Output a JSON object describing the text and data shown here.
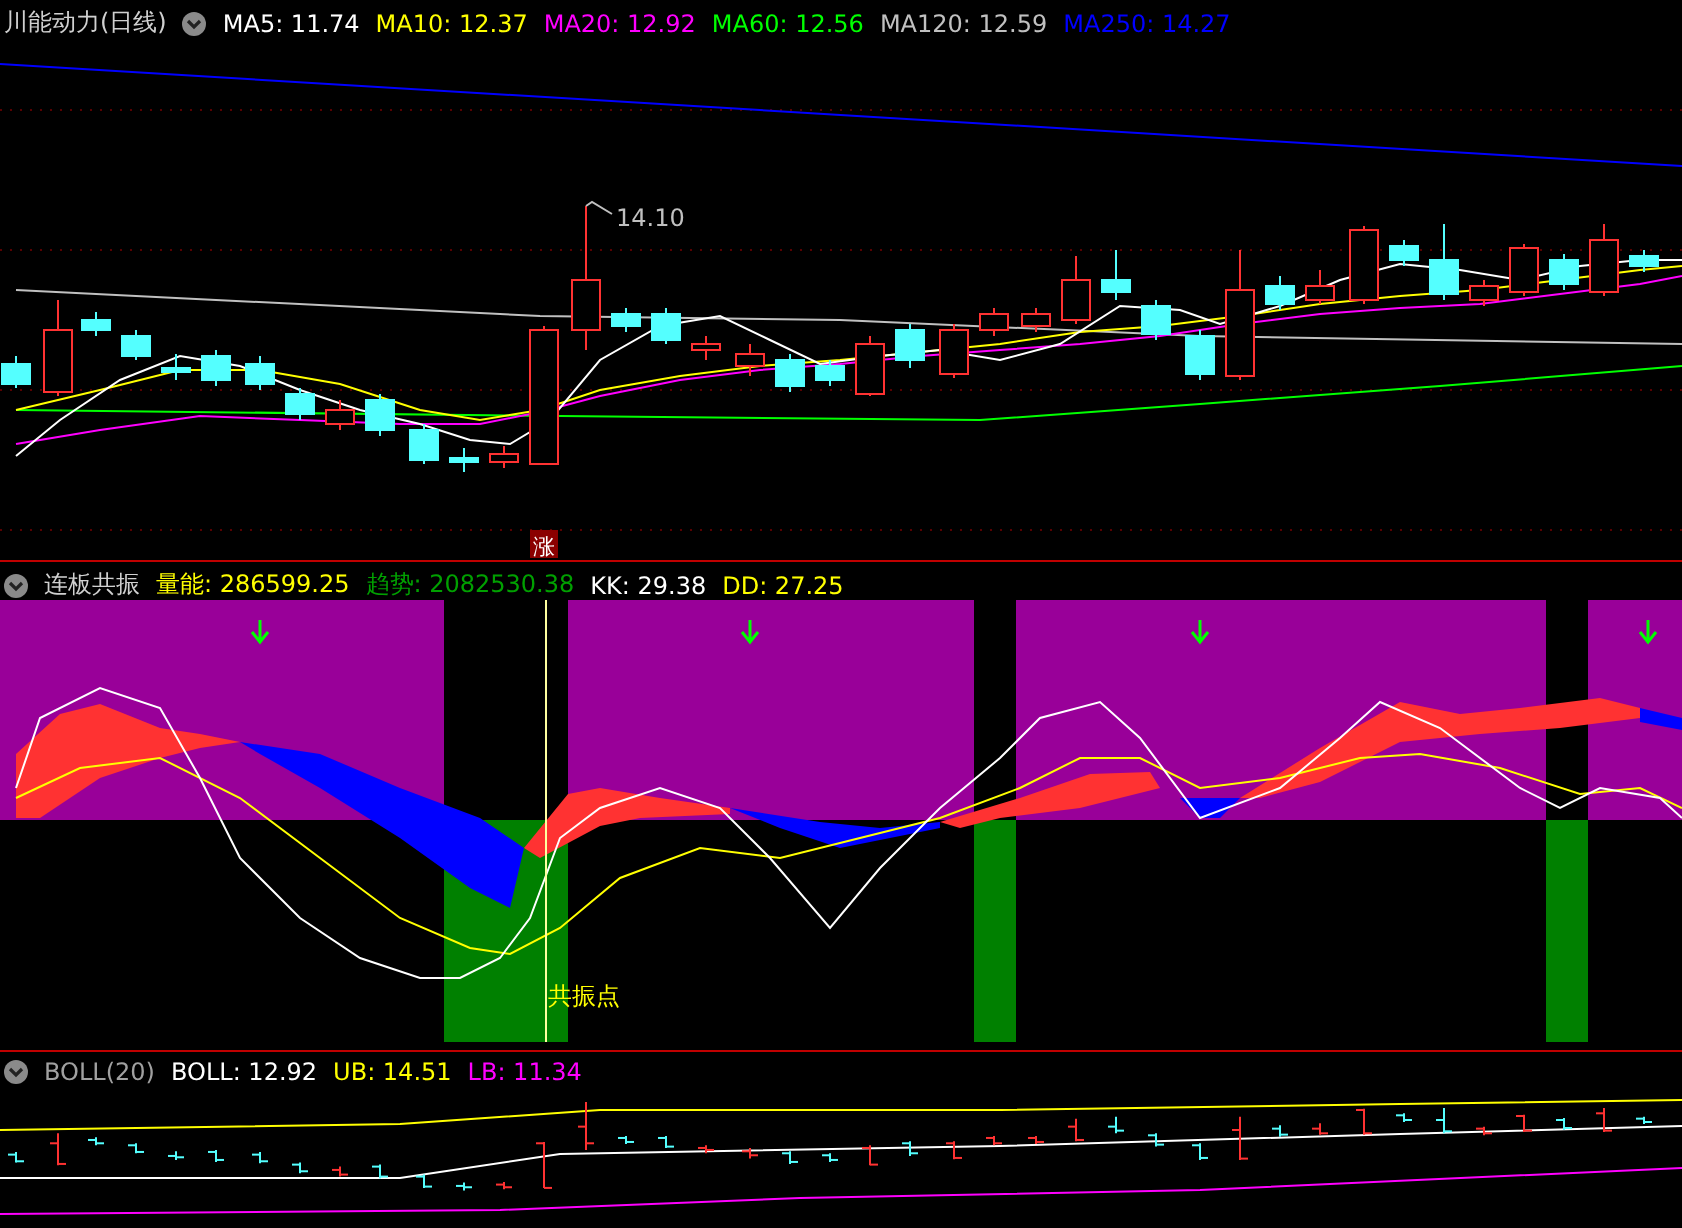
{
  "price_pane": {
    "title": "川能动力(日线)",
    "indicators": [
      {
        "label": "MA5: 11.74",
        "color": "#ffffff"
      },
      {
        "label": "MA10: 12.37",
        "color": "#ffff00"
      },
      {
        "label": "MA20: 12.92",
        "color": "#ff00ff"
      },
      {
        "label": "MA60: 12.56",
        "color": "#00ff00"
      },
      {
        "label": "MA120: 12.59",
        "color": "#c0c0c0"
      },
      {
        "label": "MA250: 14.27",
        "color": "#0000ff"
      }
    ],
    "price_label": "14.10",
    "badge": "涨"
  },
  "signal_pane": {
    "title": "连板共振",
    "indicators": [
      {
        "label": "量能: 286599.25",
        "color": "#ffff00"
      },
      {
        "label": "趋势: 2082530.38",
        "color": "#00a000"
      },
      {
        "label": "KK: 29.38",
        "color": "#ffffff"
      },
      {
        "label": "DD: 27.25",
        "color": "#ffff00"
      }
    ],
    "signal_label": "共振点"
  },
  "boll_pane": {
    "title": "BOLL(20)",
    "indicators": [
      {
        "label": "BOLL: 12.92",
        "color": "#ffffff"
      },
      {
        "label": "UB: 14.51",
        "color": "#ffff00"
      },
      {
        "label": "LB: 11.34",
        "color": "#ff00ff"
      }
    ]
  }
}
